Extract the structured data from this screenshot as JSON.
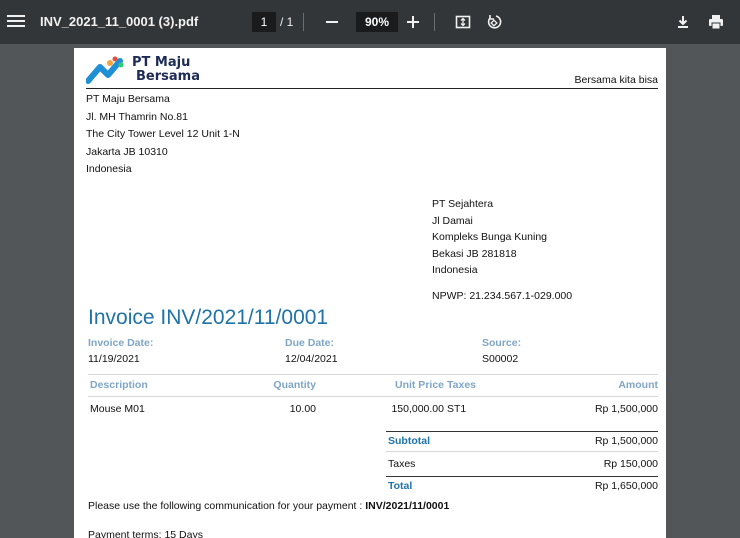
{
  "toolbar": {
    "file_name": "INV_2021_11_0001 (3).pdf",
    "current_page": "1",
    "page_total": "/ 1",
    "zoom": "90%",
    "icons": [
      "menu-icon",
      "zoom-out-icon",
      "zoom-in-icon",
      "fit-page-icon",
      "rotate-icon",
      "download-icon",
      "print-icon"
    ]
  },
  "company": {
    "logo_line1": "PT Maju",
    "logo_line2": "Bersama",
    "tagline": "Bersama kita bisa",
    "address": [
      "PT Maju Bersama",
      "Jl. MH Thamrin No.81",
      "The City Tower Level 12 Unit 1-N",
      "Jakarta JB 10310",
      "Indonesia"
    ]
  },
  "customer": {
    "address": [
      "PT Sejahtera",
      "Jl Damai",
      "Kompleks Bunga Kuning",
      "Bekasi JB 281818",
      "Indonesia"
    ],
    "npwp": "NPWP: 21.234.567.1-029.000"
  },
  "invoice": {
    "title": "Invoice INV/2021/11/0001",
    "date_label": "Invoice Date:",
    "date_value": "11/19/2021",
    "due_label": "Due Date:",
    "due_value": "12/04/2021",
    "source_label": "Source:",
    "source_value": "S00002"
  },
  "table": {
    "headers": {
      "description": "Description",
      "quantity": "Quantity",
      "unit_price": "Unit Price",
      "taxes": "Taxes",
      "amount": "Amount"
    },
    "rows": [
      {
        "description": "Mouse M01",
        "quantity": "10.00",
        "unit_price": "150,000.00",
        "taxes": "ST1",
        "amount": "Rp 1,500,000"
      }
    ]
  },
  "totals": {
    "subtotal_label": "Subtotal",
    "subtotal_value": "Rp 1,500,000",
    "taxes_label": "Taxes",
    "taxes_value": "Rp 150,000",
    "total_label": "Total",
    "total_value": "Rp 1,650,000"
  },
  "footer": {
    "communication_text": "Please use the following communication for your payment : ",
    "communication_ref": "INV/2021/11/0001",
    "payment_terms": "Payment terms: 15 Days"
  },
  "colors": {
    "toolbar_bg": "#323639",
    "viewer_bg": "#525659",
    "accent_blue": "#1f73a8",
    "label_blue": "#7fa6c5"
  }
}
